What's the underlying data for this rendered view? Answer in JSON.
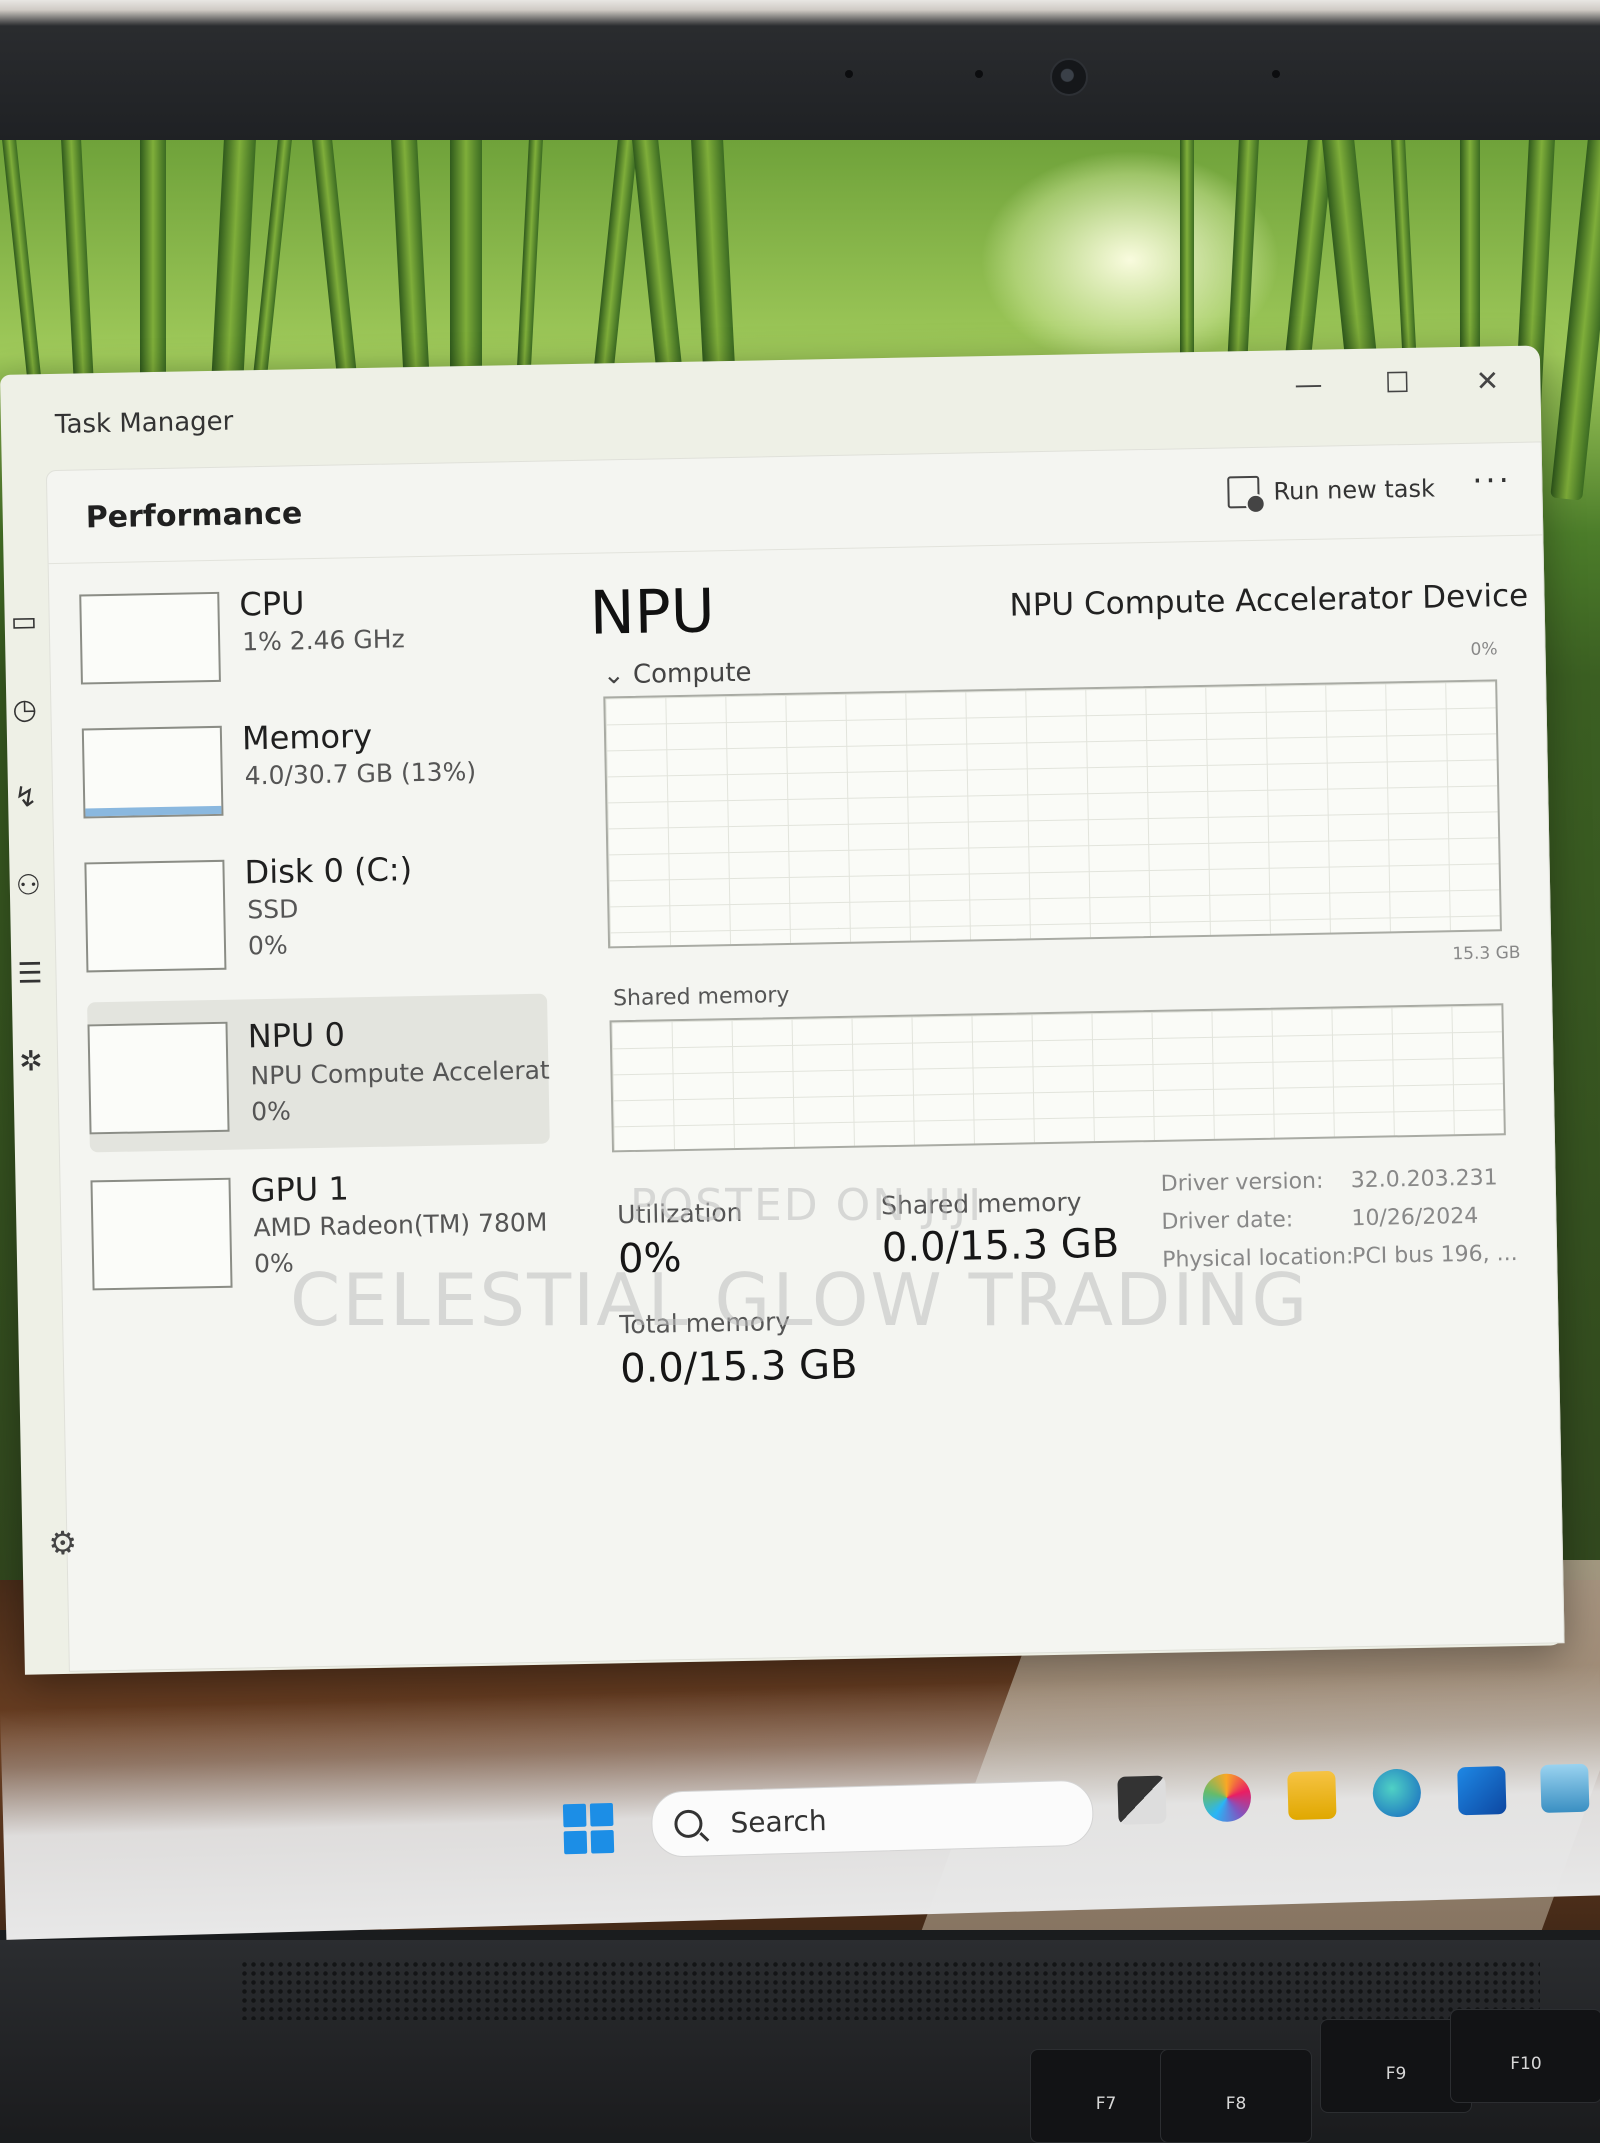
{
  "window": {
    "title": "Task Manager",
    "minimize_glyph": "—",
    "maximize_glyph": "☐",
    "close_glyph": "✕"
  },
  "header": {
    "title": "Performance",
    "run_new_task": "Run new task",
    "more_glyph": "···"
  },
  "sidebar": {
    "items": [
      {
        "name": "CPU",
        "line1": "1%  2.46 GHz",
        "line2": ""
      },
      {
        "name": "Memory",
        "line1": "4.0/30.7 GB (13%)",
        "line2": ""
      },
      {
        "name": "Disk 0 (C:)",
        "line1": "SSD",
        "line2": "0%"
      },
      {
        "name": "NPU 0",
        "line1": "NPU Compute Accelerat",
        "line2": "0%"
      },
      {
        "name": "GPU 1",
        "line1": "AMD Radeon(TM) 780M",
        "line2": "0%"
      }
    ],
    "memory_usage_fraction": 0.13
  },
  "detail": {
    "title": "NPU",
    "device": "NPU Compute Accelerator Device",
    "compute_label": "Compute",
    "compute_max": "0%",
    "shared_max": "15.3 GB",
    "shared_label": "Shared memory",
    "utilization_label": "Utilization",
    "utilization_value": "0%",
    "shared_memory_label": "Shared memory",
    "shared_memory_value": "0.0/15.3 GB",
    "total_memory_label": "Total memory",
    "total_memory_value": "0.0/15.3 GB",
    "info": [
      {
        "key": "Driver version:",
        "value": "32.0.203.231"
      },
      {
        "key": "Driver date:",
        "value": "10/26/2024"
      },
      {
        "key": "Physical location:",
        "value": "PCI bus 196, ..."
      }
    ]
  },
  "taskbar": {
    "search_placeholder": "Search"
  },
  "keys": [
    "F7",
    "F8",
    "F9",
    "F10"
  ],
  "watermark": {
    "line1": "POSTED ON JIJI",
    "line2": "CELESTIAL GLOW TRADING"
  },
  "colors": {
    "accent": "#1c8ee6",
    "memory_graph": "#6ea6d8"
  }
}
